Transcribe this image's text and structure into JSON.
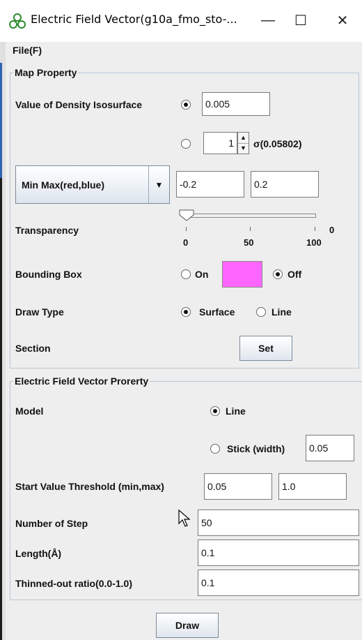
{
  "window": {
    "title": "Electric Field Vector(g10a_fmo_sto-...",
    "minimize": "—",
    "maximize": "☐",
    "close": "✕"
  },
  "menu": {
    "file": "File(F)"
  },
  "map_property": {
    "legend": "Map Property",
    "density_label": "Value of Density Isosurface",
    "density_value": "0.005",
    "sigma_value": "1",
    "sigma_text": "σ(0.05802)",
    "minmax_select": "Min Max(red,blue)",
    "min_value": "-0.2",
    "max_value": "0.2",
    "transparency_label": "Transparency",
    "transparency_value": 0,
    "transparency_display": "0",
    "transparency_ticks": [
      "0",
      "50",
      "100"
    ],
    "bounding_box_label": "Bounding Box",
    "bbox_on": "On",
    "bbox_off": "Off",
    "bbox_color": "#ff66ff",
    "draw_type_label": "Draw Type",
    "draw_surface": "Surface",
    "draw_line": "Line",
    "section_label": "Section",
    "set_button": "Set"
  },
  "efv": {
    "legend": "Electric Field Vector Prorerty",
    "model_label": "Model",
    "model_line": "Line",
    "model_stick": "Stick (width)",
    "stick_width": "0.05",
    "start_threshold_label": "Start Value Threshold (min,max)",
    "start_min": "0.05",
    "start_max": "1.0",
    "num_step_label": "Number of Step",
    "num_step": "50",
    "length_label": "Length(Å)",
    "length": "0.1",
    "thinned_label": "Thinned-out ratio(0.0-1.0)",
    "thinned": "0.1"
  },
  "draw_button": "Draw"
}
